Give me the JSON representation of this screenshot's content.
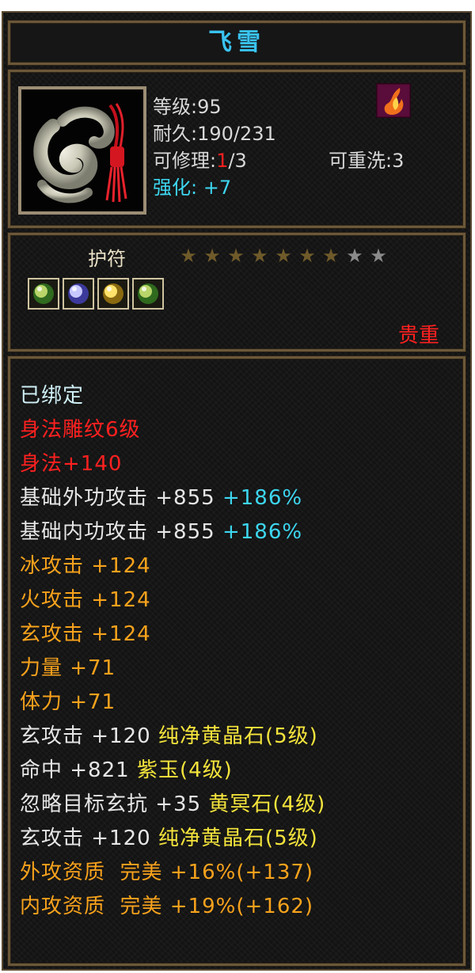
{
  "item": {
    "name": "飞雪",
    "icon": "jade-pendant-image",
    "level_text": "等级:95",
    "durability_label": "耐久:",
    "durability_value": "190/231",
    "repair_label": "可修理:",
    "repair_used": "1",
    "repair_total": "/3",
    "rewash_text": "可重洗:3",
    "enhance_label": "强化:",
    "enhance_value": "+7",
    "category": "护符",
    "stars": {
      "lit": 7,
      "total": 9
    },
    "gems": [
      "green-gem",
      "purple-gem",
      "yellow-gem",
      "green-gem"
    ],
    "rarity": "贵重",
    "bound": "已绑定"
  },
  "colors": {
    "cyan": "#3dd6f0",
    "red": "#ff2020",
    "orange": "#f7a21c",
    "yellow": "#f4e43c",
    "white": "#e6e6e6",
    "title": "#39c3f2"
  },
  "attributes": [
    {
      "parts": [
        {
          "text": "身法雕纹6级",
          "color": "red"
        }
      ]
    },
    {
      "parts": [
        {
          "text": "身法+140",
          "color": "red"
        }
      ]
    },
    {
      "parts": [
        {
          "text": "基础外功攻击 +855 ",
          "color": "white"
        },
        {
          "text": "+186%",
          "color": "cyan"
        }
      ]
    },
    {
      "parts": [
        {
          "text": "基础内功攻击 +855 ",
          "color": "white"
        },
        {
          "text": "+186%",
          "color": "cyan"
        }
      ]
    },
    {
      "parts": [
        {
          "text": "冰攻击 +124",
          "color": "orange"
        }
      ]
    },
    {
      "parts": [
        {
          "text": "火攻击 +124",
          "color": "orange"
        }
      ]
    },
    {
      "parts": [
        {
          "text": "玄攻击 +124",
          "color": "orange"
        }
      ]
    },
    {
      "parts": [
        {
          "text": "力量 +71",
          "color": "orange"
        }
      ]
    },
    {
      "parts": [
        {
          "text": "体力 +71",
          "color": "orange"
        }
      ]
    },
    {
      "parts": [
        {
          "text": "玄攻击 +120 ",
          "color": "white"
        },
        {
          "text": "纯净黄晶石(5级)",
          "color": "yellow"
        }
      ]
    },
    {
      "parts": [
        {
          "text": "命中 +821 ",
          "color": "white"
        },
        {
          "text": "紫玉(4级)",
          "color": "yellow"
        }
      ]
    },
    {
      "parts": [
        {
          "text": "忽略目标玄抗 +35 ",
          "color": "white"
        },
        {
          "text": "黄冥石(4级)",
          "color": "yellow"
        }
      ]
    },
    {
      "parts": [
        {
          "text": "玄攻击 +120 ",
          "color": "white"
        },
        {
          "text": "纯净黄晶石(5级)",
          "color": "yellow"
        }
      ]
    },
    {
      "parts": [
        {
          "text": "外攻资质  完美 +16%(+137)",
          "color": "orange"
        }
      ]
    },
    {
      "parts": [
        {
          "text": "内攻资质  完美 +19%(+162)",
          "color": "orange"
        }
      ]
    }
  ]
}
